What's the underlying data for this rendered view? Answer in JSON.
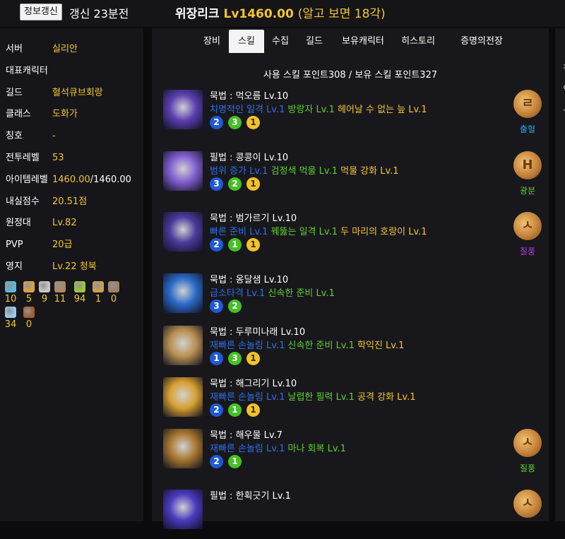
{
  "header": {
    "refresh_button": "정보갱신",
    "refresh_time": "갱신 23분전",
    "name": "위장리크",
    "level": "Lv1460.00",
    "extra": "(알고 보면 18각)"
  },
  "sidebar": {
    "rows": [
      {
        "label": "서버",
        "value": "실리안"
      },
      {
        "label": "대표캐릭터",
        "value": ""
      },
      {
        "label": "길드",
        "value": "혈석큐브회랑"
      },
      {
        "label": "클래스",
        "value": "도화가"
      },
      {
        "label": "칭호",
        "value": "-"
      },
      {
        "label": "전투레벨",
        "value": "53"
      },
      {
        "label": "아이템레벨",
        "value": "1460.00",
        "value_suffix": "/1460.00"
      },
      {
        "label": "내실점수",
        "value": "20.51점"
      },
      {
        "label": "원정대",
        "value": "Lv.82"
      },
      {
        "label": "PVP",
        "value": "20급"
      },
      {
        "label": "영지",
        "value": "Lv.22 청북"
      }
    ],
    "collectibles": [
      {
        "icon": "island-heart-icon",
        "count": "10",
        "color": "#58b8e0"
      },
      {
        "icon": "star-seed-icon",
        "count": "5",
        "color": "#e0a040"
      },
      {
        "icon": "giant-heart-icon",
        "count": "9",
        "color": "#c8c8c8"
      },
      {
        "icon": "art-icon",
        "count": "11",
        "color": "#b08860"
      },
      {
        "icon": "mokoko-seed-icon",
        "count": "94",
        "color": "#9ac83a"
      },
      {
        "icon": "voyage-icon",
        "count": "1",
        "color": "#d0a050"
      },
      {
        "icon": "ignea-token-icon",
        "count": "0",
        "color": "#a08060"
      },
      {
        "icon": "world-tree-leaf-icon",
        "count": "34",
        "color": "#9ac8f0"
      },
      {
        "icon": "orpheus-star-icon",
        "count": "0",
        "color": "#a06030"
      }
    ]
  },
  "tabs": [
    "장비",
    "스킬",
    "수집",
    "길드",
    "보유캐릭터",
    "히스토리",
    "증명의전장"
  ],
  "active_tab": "스킬",
  "skill_points": "사용 스킬 포인트308 / 보유 스킬 포인트327",
  "skills": [
    {
      "name": "묵법 : 먹오름 Lv.10",
      "tripods": [
        {
          "text": "치명적인 일격 Lv.1",
          "color": "blue"
        },
        {
          "text": "방랑자 Lv.1",
          "color": "green"
        },
        {
          "text": "헤어날 수 없는 늪 Lv.1",
          "color": "yellow"
        }
      ],
      "levels": [
        {
          "n": "2",
          "color": "blue"
        },
        {
          "n": "3",
          "color": "green"
        },
        {
          "n": "1",
          "color": "yellow"
        }
      ],
      "icon_color": "#5a3fb0",
      "rune": {
        "name": "출혈",
        "glyph": "ㄹ",
        "color": "#2ea0e6"
      }
    },
    {
      "name": "필법 : 콩콩이 Lv.10",
      "tripods": [
        {
          "text": "범위 증가 Lv.1",
          "color": "blue"
        },
        {
          "text": "검정색 먹물 Lv.1",
          "color": "green"
        },
        {
          "text": "먹물 강화 Lv.1",
          "color": "yellow"
        }
      ],
      "levels": [
        {
          "n": "3",
          "color": "blue"
        },
        {
          "n": "2",
          "color": "green"
        },
        {
          "n": "1",
          "color": "yellow"
        }
      ],
      "icon_color": "#8060d0",
      "rune": {
        "name": "광분",
        "glyph": "H",
        "color": "#5ecf2e"
      }
    },
    {
      "name": "묵법 : 범가르기 Lv.10",
      "tripods": [
        {
          "text": "빠른 준비 Lv.1",
          "color": "blue"
        },
        {
          "text": "꿰뚫는 일격 Lv.1",
          "color": "green"
        },
        {
          "text": "두 마리의 호랑이 Lv.1",
          "color": "yellow"
        }
      ],
      "levels": [
        {
          "n": "2",
          "color": "blue"
        },
        {
          "n": "1",
          "color": "green"
        },
        {
          "n": "1",
          "color": "yellow"
        }
      ],
      "icon_color": "#4a3a9a",
      "rune": {
        "name": "질풍",
        "glyph": "ㅅ",
        "color": "#b040e0"
      }
    },
    {
      "name": "묵법 : 옹달샘 Lv.10",
      "tripods": [
        {
          "text": "급소타격 Lv.1",
          "color": "blue"
        },
        {
          "text": "신속한 준비 Lv.1",
          "color": "green"
        }
      ],
      "levels": [
        {
          "n": "3",
          "color": "blue"
        },
        {
          "n": "2",
          "color": "green"
        }
      ],
      "icon_color": "#2a6ac8",
      "rune": null
    },
    {
      "name": "묵법 : 두루미나래 Lv.10",
      "tripods": [
        {
          "text": "재빠른 손놀림 Lv.1",
          "color": "blue"
        },
        {
          "text": "신속한 준비 Lv.1",
          "color": "green"
        },
        {
          "text": "학익진 Lv.1",
          "color": "yellow"
        }
      ],
      "levels": [
        {
          "n": "1",
          "color": "blue"
        },
        {
          "n": "3",
          "color": "green"
        },
        {
          "n": "1",
          "color": "yellow"
        }
      ],
      "icon_color": "#b89050",
      "rune": null
    },
    {
      "name": "묵법 : 해그리기 Lv.10",
      "tripods": [
        {
          "text": "재빠른 손놀림 Lv.1",
          "color": "blue"
        },
        {
          "text": "날렵한 필력 Lv.1",
          "color": "green"
        },
        {
          "text": "공격 강화 Lv.1",
          "color": "yellow"
        }
      ],
      "levels": [
        {
          "n": "2",
          "color": "blue"
        },
        {
          "n": "1",
          "color": "green"
        },
        {
          "n": "1",
          "color": "yellow"
        }
      ],
      "icon_color": "#d8a030",
      "rune": null
    },
    {
      "name": "묵법 : 해우물 Lv.7",
      "tripods": [
        {
          "text": "재빠른 손놀림 Lv.1",
          "color": "blue"
        },
        {
          "text": "마나 회복 Lv.1",
          "color": "green"
        }
      ],
      "levels": [
        {
          "n": "2",
          "color": "blue"
        },
        {
          "n": "1",
          "color": "green"
        }
      ],
      "icon_color": "#a87830",
      "rune": {
        "name": "질풍",
        "glyph": "ㅅ",
        "color": "#5ecf2e"
      }
    },
    {
      "name": "필법 : 한획긋기 Lv.1",
      "tripods": [],
      "levels": [],
      "icon_color": "#4a3ac0",
      "rune": {
        "name": "",
        "glyph": "ㅅ",
        "color": "#5ecf2e"
      }
    }
  ],
  "right_column_chars": [
    "ㅊ",
    "ㅇ",
    "ㅅ"
  ]
}
